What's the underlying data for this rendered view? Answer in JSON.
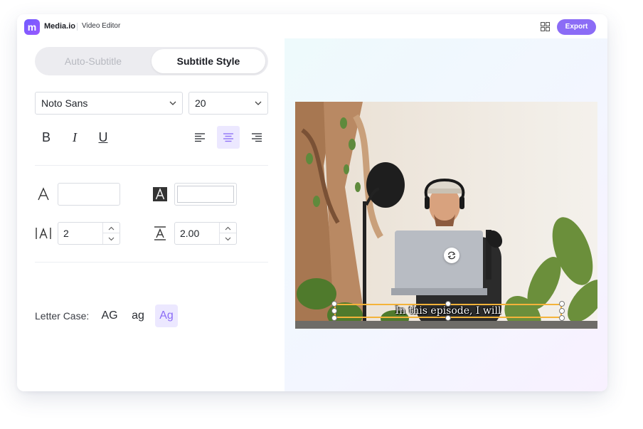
{
  "header": {
    "logo_letter": "m",
    "app_name": "Media.io",
    "module": "Video Editor",
    "export_label": "Export",
    "accent_color": "#8b6cf6"
  },
  "tabs": [
    {
      "label": "Auto-Subtitle",
      "active": false
    },
    {
      "label": "Subtitle Style",
      "active": true
    }
  ],
  "font": {
    "family": "Noto Sans",
    "size": "20"
  },
  "formatting": {
    "bold_glyph": "B",
    "italic_glyph": "I",
    "underline_glyph": "U",
    "alignment": "center"
  },
  "colors": {
    "text_color": "",
    "background_color": ""
  },
  "spacing": {
    "letter_spacing": "2",
    "line_height": "2.00"
  },
  "letter_case": {
    "label": "Letter Case:",
    "options": [
      "AG",
      "ag",
      "Ag"
    ],
    "selected": "Ag"
  },
  "preview": {
    "caption": "In this episode, I will",
    "caption_border_color": "#f4b33a"
  }
}
